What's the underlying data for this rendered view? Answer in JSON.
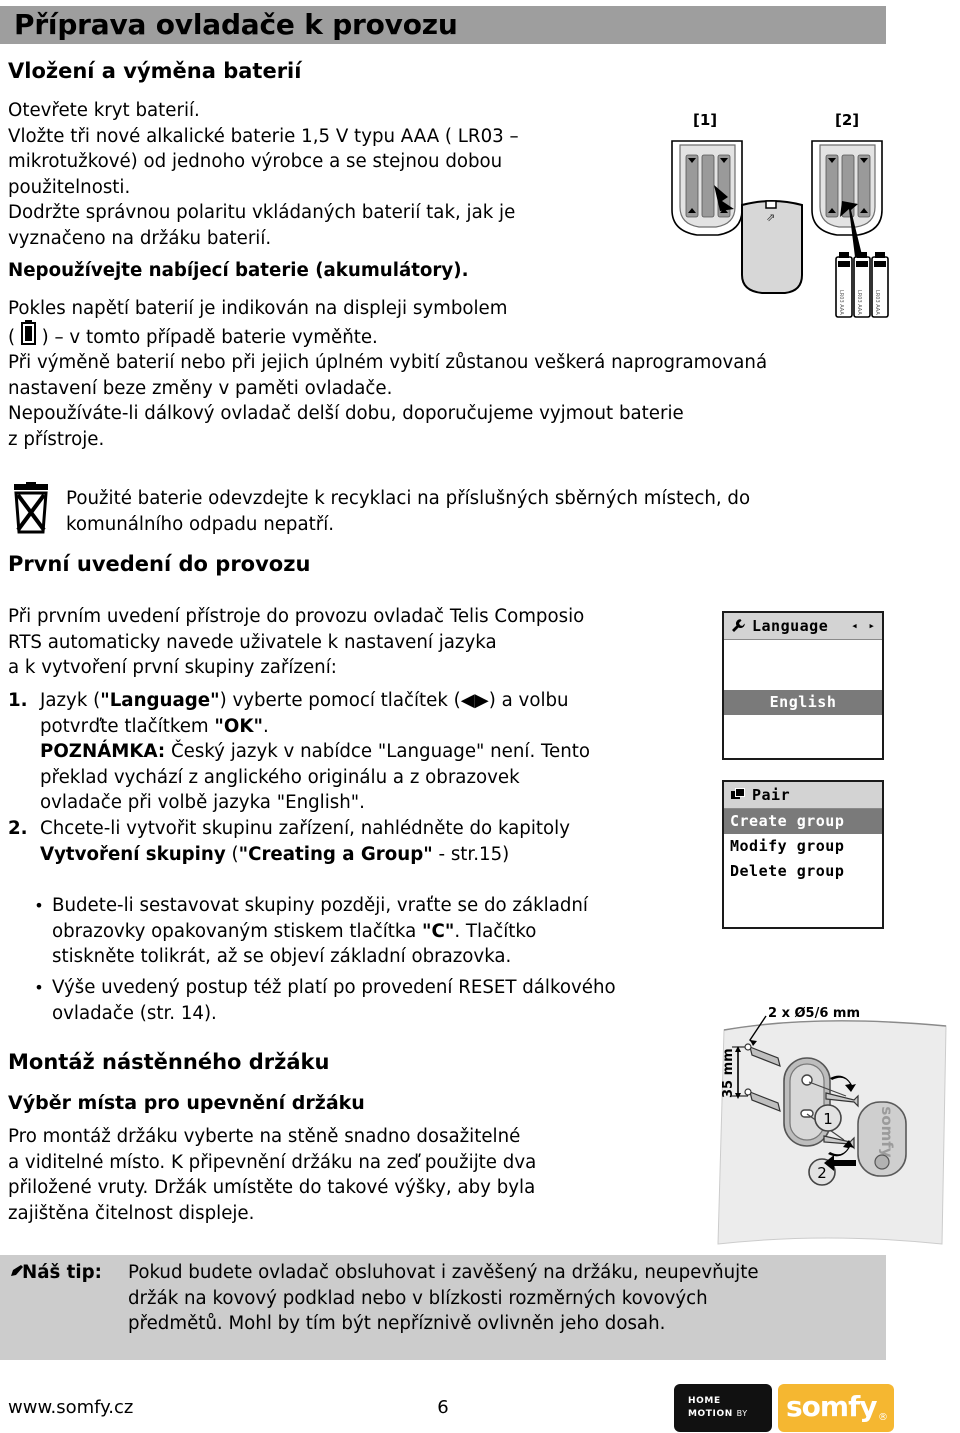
{
  "header": {
    "title": "Příprava ovladače k provozu",
    "band_color": "#9e9e9e"
  },
  "sections": {
    "batteries_heading": "Vložení a výměna baterií",
    "first_use_heading": "První uvedení do provozu",
    "mount_heading": "Montáž nástěnného držáku",
    "mount_subheading": "Výběr místa pro upevnění držáku"
  },
  "battery_text": {
    "line1": "Otevřete kryt baterií.",
    "line2": "Vložte tři nové alkalické baterie 1,5 V typu AAA ( LR03 –",
    "line3": "mikrotužkové) od jednoho výrobce a se stejnou dobou",
    "line4": "použitelnosti.",
    "line5": "Dodržte správnou polaritu vkládaných baterií tak, jak je",
    "line6": "vyznačeno na držáku baterií.",
    "bold_warning": "Nepoužívejte nabíjecí baterie (akumulátory).",
    "line7": "Pokles napětí baterií je indikován na displeji symbolem",
    "line8_pre": "( ",
    "line8_post": " ) – v tomto případě baterie vyměňte.",
    "line9": "Při výměně baterií nebo při jejich úplném vybití zůstanou veškerá naprogramovaná",
    "line10": "nastavení beze změny v paměti ovladače.",
    "line11": "Nepoužíváte-li dálkový ovladač delší dobu, doporučujeme vyjmout baterie",
    "line12": "z přístroje."
  },
  "recycle": {
    "line1": "Použité baterie odevzdejte k recyklaci na příslušných sběrných místech, do",
    "line2": "komunálního odpadu nepatří."
  },
  "first_use_text": {
    "line1": "Při prvním uvedení přístroje do provozu ovladač Telis Composio",
    "line2": "RTS automaticky navede uživatele k nastavení jazyka",
    "line3": "a k vytvoření první skupiny zařízení:"
  },
  "steps": [
    {
      "num": "1.",
      "l1_a": "Jazyk (",
      "l1_b": "\"Language\"",
      "l1_c": ") vyberte pomocí tlačítek (◀▶) a volbu",
      "l2_a": "potvrďte tlačítkem ",
      "l2_b": "\"OK\"",
      "l2_c": ".",
      "l3_a": "POZNÁMKA:",
      "l3_b": " Český jazyk v nabídce \"Language\" není. Tento",
      "l4": "překlad vychází z anglického originálu a z obrazovek",
      "l5": "ovladače při volbě jazyka \"English\"."
    },
    {
      "num": "2.",
      "l1": "Chcete-li vytvořit skupinu zařízení, nahlédněte do kapitoly",
      "l2_a": "Vytvoření skupiny",
      "l2_b": " (",
      "l2_c": "\"Creating a Group\"",
      "l2_d": " - str.15)"
    }
  ],
  "bullets": [
    {
      "l1": "Budete-li sestavovat skupiny později, vraťte se do základní",
      "l2_a": "obrazovky opakovaným stiskem tlačítka ",
      "l2_b": "\"C\"",
      "l2_c": ". Tlačítko",
      "l3": "stiskněte tolikrát, až se objeví základní obrazovka."
    },
    {
      "l1": "Výše uvedený postup též platí po provedení RESET dálkového",
      "l2": "ovladače (str. 14)."
    }
  ],
  "mount_text": {
    "line1": "Pro montáž držáku vyberte na stěně snadno dosažitelné",
    "line2": "a viditelné místo. K připevnění držáku na zeď použijte dva",
    "line3": "přiložené vruty. Držák umístěte do takové výšky, aby byla",
    "line4": "zajištěna čitelnost displeje."
  },
  "tip": {
    "label": "Náš tip:",
    "icon": "pen-icon",
    "line1": "Pokud budete ovladač obsluhovat i zavěšený na držáku, neupevňujte",
    "line2": "držák na kovový podklad nebo v blízkosti rozměrných kovových",
    "line3": "předmětů. Mohl by tím být nepříznivě ovlivněn jeho dosah.",
    "bg_color": "#cccccc"
  },
  "footer": {
    "url": "www.somfy.cz",
    "page_number": "6",
    "logo_line1": "HOME",
    "logo_line2": "MOTION",
    "logo_by": "BY",
    "logo_word": "somfy",
    "logo_reg": "®",
    "logo_yellow": "#f5b731",
    "logo_black": "#111111"
  },
  "illustrations": {
    "battery": {
      "label1": "[1]",
      "label2": "[2]"
    },
    "wall_mount": {
      "drill_label": "2 x Ø5/6 mm",
      "height_label": "35 mm",
      "step1": "1",
      "step2": "2",
      "brand": "somfy"
    }
  },
  "lcd_language": {
    "title": "Language",
    "title_icon": "wrench-icon",
    "arrows": "◂ ▸",
    "rows": [
      {
        "label": "",
        "selected": false
      },
      {
        "label": "",
        "selected": false
      },
      {
        "label": "English",
        "selected": true,
        "center": true
      },
      {
        "label": "",
        "selected": false
      },
      {
        "label": "",
        "selected": false
      }
    ]
  },
  "lcd_pair": {
    "title": "Pair",
    "title_icon": "copy-icon",
    "rows": [
      {
        "label": "Create group",
        "selected": true
      },
      {
        "label": "Modify group",
        "selected": false
      },
      {
        "label": "Delete group",
        "selected": false
      },
      {
        "label": "",
        "selected": false
      },
      {
        "label": "",
        "selected": false
      },
      {
        "label": "",
        "selected": false
      }
    ]
  }
}
